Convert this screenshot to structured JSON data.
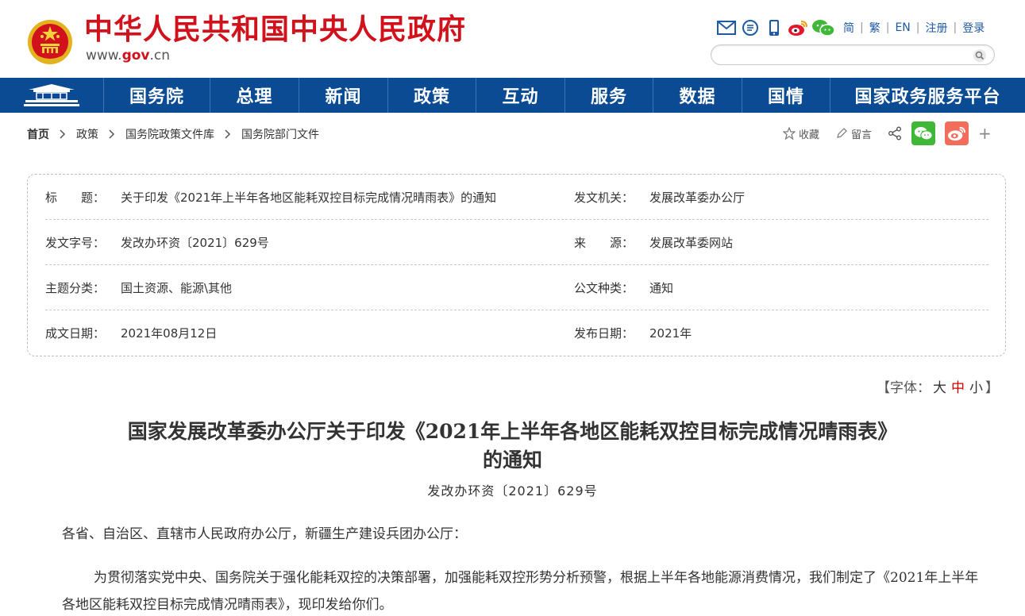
{
  "header": {
    "site_title": "中华人民共和国中央人民政府",
    "site_url_prefix": "www.",
    "site_url_brand": "gov",
    "site_url_suffix": ".cn",
    "tools": [
      {
        "icon": "mail-icon"
      },
      {
        "icon": "message-icon"
      },
      {
        "icon": "mobile-icon"
      },
      {
        "icon": "weibo-icon"
      },
      {
        "icon": "wechat-icon"
      }
    ],
    "lang_links": [
      "简",
      "繁",
      "EN",
      "注册",
      "登录"
    ],
    "search_placeholder": ""
  },
  "nav": {
    "items": [
      "国务院",
      "总理",
      "新闻",
      "政策",
      "互动",
      "服务",
      "数据",
      "国情",
      "国家政务服务平台"
    ]
  },
  "breadcrumb": [
    "首页",
    "政策",
    "国务院政策文件库",
    "国务院部门文件"
  ],
  "share": {
    "collect": "收藏",
    "comment": "留言",
    "wechat_color": "#3fb837",
    "weibo_color": "#f26d5b"
  },
  "info": {
    "rows": [
      {
        "l_label": "标　　题：",
        "l_value": "关于印发《2021年上半年各地区能耗双控目标完成情况晴雨表》的通知",
        "r_label": "发文机关：",
        "r_value": "发展改革委办公厅"
      },
      {
        "l_label": "发文字号：",
        "l_value": "发改办环资〔2021〕629号",
        "r_label": "来　　源：",
        "r_value": "发展改革委网站"
      },
      {
        "l_label": "主题分类：",
        "l_value": "国土资源、能源\\其他",
        "r_label": "公文种类：",
        "r_value": "通知"
      },
      {
        "l_label": "成文日期：",
        "l_value": "2021年08月12日",
        "r_label": "发布日期：",
        "r_value": "2021年"
      }
    ]
  },
  "fontsize": {
    "open": "【字体：",
    "large": "大",
    "medium": "中",
    "small": "小",
    "close": "】"
  },
  "article": {
    "title_line1": "国家发展改革委办公厅关于印发《2021年上半年各地区能耗双控目标完成情况晴雨表》",
    "title_line2": "的通知",
    "doc_no": "发改办环资〔2021〕629号",
    "p1": "各省、自治区、直辖市人民政府办公厅，新疆生产建设兵团办公厅：",
    "p2": "为贯彻落实党中央、国务院关于强化能耗双控的决策部署，加强能耗双控形势分析预警，根据上半年各地能源消费情况，我们制定了《2021年上半年各地区能耗双控目标完成情况晴雨表》，现印发给你们。"
  },
  "colors": {
    "brand_red": "#d1111b",
    "nav_blue": "#0a4b93",
    "link_blue": "#1e5aa6"
  }
}
